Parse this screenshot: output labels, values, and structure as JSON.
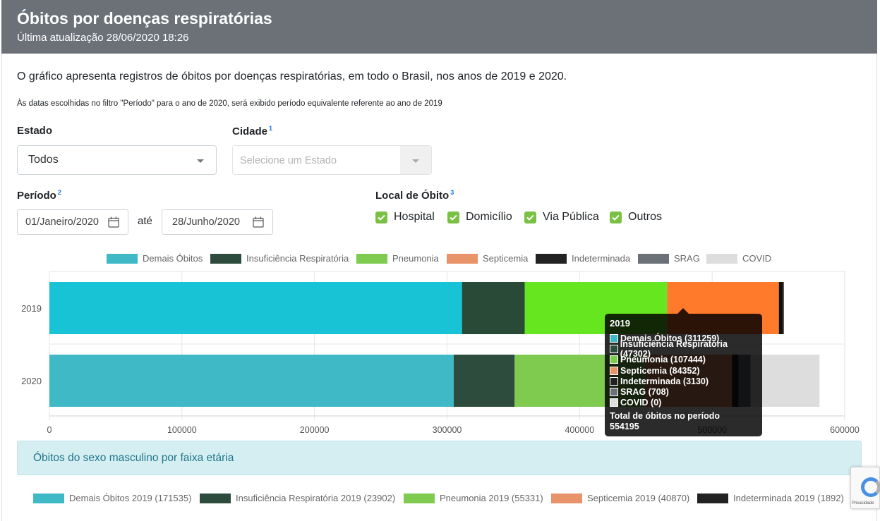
{
  "header": {
    "title": "Óbitos por doenças respiratórias",
    "updated": "Última atualização 28/06/2020 18:26"
  },
  "description": "O gráfico apresenta registros de óbitos por doenças respiratórias, em todo o Brasil, nos anos de 2019 e 2020.",
  "note": "Às datas escolhidas no filtro \"Período\" para o ano de 2020, será exibido período equivalente referente ao ano de 2019",
  "filters": {
    "estado_label": "Estado",
    "estado_value": "Todos",
    "cidade_label": "Cidade",
    "cidade_sup": "1",
    "cidade_placeholder": "Selecione um Estado",
    "periodo_label": "Período",
    "periodo_sup": "2",
    "date_start": "01/Janeiro/2020",
    "date_sep": "até",
    "date_end": "28/Junho/2020",
    "local_label": "Local de Óbito",
    "local_sup": "3",
    "local_options": [
      "Hospital",
      "Domicílio",
      "Via Pública",
      "Outros"
    ]
  },
  "chart_data": {
    "type": "bar",
    "orientation": "horizontal",
    "stacked": true,
    "categories": [
      "2019",
      "2020"
    ],
    "xlim": [
      0,
      600000
    ],
    "xticks": [
      0,
      100000,
      200000,
      300000,
      400000,
      500000,
      600000
    ],
    "xtick_labels": [
      "0",
      "100000",
      "200000",
      "300000",
      "400000",
      "500000",
      "600000"
    ],
    "grid": true,
    "legend_position": "top",
    "series": [
      {
        "name": "Demais Óbitos",
        "color": "#3fb9c6",
        "values": [
          311259,
          305000
        ]
      },
      {
        "name": "Insuficiência Respiratória",
        "color": "#2e4c3e",
        "values": [
          47302,
          46000
        ]
      },
      {
        "name": "Pneumonia",
        "color": "#7ecb50",
        "values": [
          107444,
          98000
        ]
      },
      {
        "name": "Septicemia",
        "color": "#e8936a",
        "values": [
          84352,
          66000
        ]
      },
      {
        "name": "Indeterminada",
        "color": "#222222",
        "values": [
          3130,
          5000
        ]
      },
      {
        "name": "SRAG",
        "color": "#6c7178",
        "values": [
          708,
          9000
        ]
      },
      {
        "name": "COVID",
        "color": "#dddddd",
        "values": [
          0,
          52000
        ]
      }
    ],
    "highlight_colors": {
      "2019": [
        "#17c3d4",
        "#2a4a38",
        "#66e61e",
        "#ff7a2a",
        "#111111",
        "#555555",
        "#dddddd"
      ]
    }
  },
  "tooltip": {
    "title": "2019",
    "rows": [
      {
        "label": "Demais Óbitos (311259)",
        "color": "#3fb9c6"
      },
      {
        "label": "Insuficiência Respiratória (47302)",
        "color": "#2e4c3e"
      },
      {
        "label": "Pneumonia (107444)",
        "color": "#7ecb50"
      },
      {
        "label": "Septicemia (84352)",
        "color": "#e8936a"
      },
      {
        "label": "Indeterminada (3130)",
        "color": "#222222"
      },
      {
        "label": "SRAG (708)",
        "color": "#6c7178"
      },
      {
        "label": "COVID (0)",
        "color": "#dddddd"
      }
    ],
    "total_label": "Total de óbitos no período",
    "total_value": "554195"
  },
  "masculino": {
    "title": "Óbitos do sexo masculino por faixa etária",
    "legend": [
      {
        "label": "Demais Óbitos 2019 (171535)",
        "color": "#3fb9c6"
      },
      {
        "label": "Insuficiência Respiratória 2019 (23902)",
        "color": "#2e4c3e"
      },
      {
        "label": "Pneumonia 2019 (55331)",
        "color": "#7ecb50"
      },
      {
        "label": "Septicemia 2019 (40870)",
        "color": "#e8936a"
      },
      {
        "label": "Indeterminada 2019 (1892)",
        "color": "#222222"
      }
    ]
  },
  "recaptcha_text": "Privacidade",
  "icons": {
    "calendar": "calendar-icon",
    "dropdown": "chevron-down-icon",
    "check": "check-icon"
  }
}
